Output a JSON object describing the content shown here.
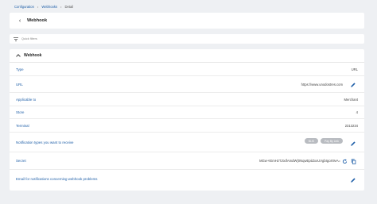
{
  "breadcrumb": {
    "items": [
      "Configuration",
      "Webhooks",
      "Detail"
    ],
    "separator": "•"
  },
  "header": {
    "back_icon": "chevron-left-icon",
    "title": "Webhook"
  },
  "filters": {
    "icon": "filter-icon",
    "label": "Quick filters"
  },
  "section": {
    "title": "Webhook",
    "rows": [
      {
        "label": "Type",
        "value": "URL"
      },
      {
        "label": "URL",
        "value": "https://www.unodostres.com"
      },
      {
        "label": "Applicable to",
        "value": "Merchant"
      },
      {
        "label": "Store",
        "value": "4"
      },
      {
        "label": "Terminal",
        "value": "2313234"
      },
      {
        "label": "Notification types you want to receive",
        "tags": [
          "BLIK",
          "Pay By Link"
        ]
      },
      {
        "label": "Secret",
        "value": "MGw+IEmHzTJtxifAmdW{0NqwEpiiZxxUVgbIgoX9vA="
      },
      {
        "label": "Email for notifications concerning webhook problems",
        "value": ""
      }
    ]
  },
  "colors": {
    "link": "#1f5fa8",
    "background": "#eef0f3",
    "tag": "#b9bcc1"
  }
}
